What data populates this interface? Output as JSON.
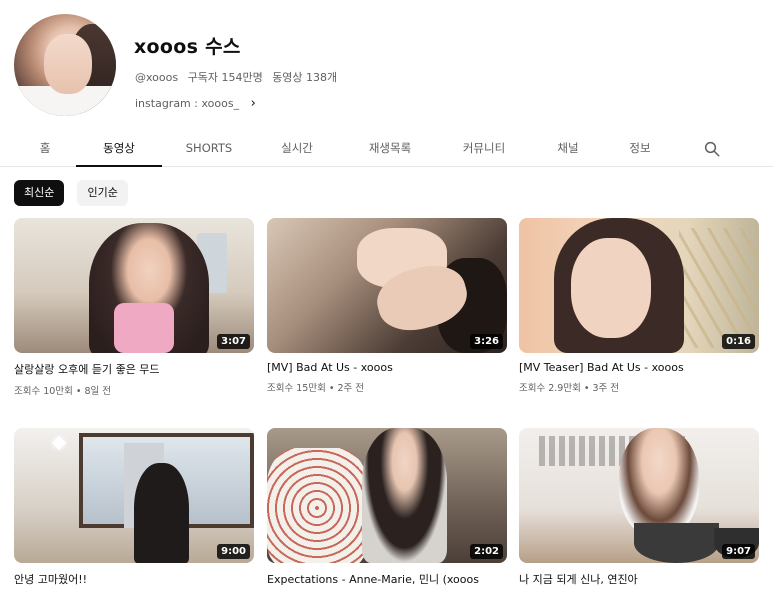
{
  "channel": {
    "name": "xooos 수스",
    "handle": "@xooos",
    "subscribers": "구독자 154만명",
    "video_count": "동영상 138개",
    "link_text": "instagram : xooos_"
  },
  "tabs": [
    {
      "label": "홈"
    },
    {
      "label": "동영상"
    },
    {
      "label": "SHORTS"
    },
    {
      "label": "실시간"
    },
    {
      "label": "재생목록"
    },
    {
      "label": "커뮤니티"
    },
    {
      "label": "채널"
    },
    {
      "label": "정보"
    }
  ],
  "active_tab": "동영상",
  "chips": [
    {
      "label": "최신순"
    },
    {
      "label": "인기순"
    }
  ],
  "videos": [
    {
      "title": "살랑살랑 오후에 듣기 좋은 무드",
      "meta": "조회수 10만회 • 8일 전",
      "duration": "3:07"
    },
    {
      "title": "[MV] Bad At Us - xooos",
      "meta": "조회수 15만회 • 2주 전",
      "duration": "3:26"
    },
    {
      "title": "[MV Teaser] Bad At Us - xooos",
      "meta": "조회수 2.9만회 • 3주 전",
      "duration": "0:16"
    },
    {
      "title": "안녕 고마웠어!!",
      "meta": "",
      "duration": "9:00"
    },
    {
      "title": "Expectations - Anne-Marie, 민니 (xooos",
      "meta": "",
      "duration": "2:02"
    },
    {
      "title": "나 지금 되게 신나, 연진아",
      "meta": "",
      "duration": "9:07"
    }
  ],
  "colors": {
    "text_primary": "#0f0f0f",
    "text_secondary": "#606060",
    "chip_active_bg": "#0f0f0f",
    "chip_bg": "#f2f2f2",
    "divider": "#e5e5e5"
  }
}
